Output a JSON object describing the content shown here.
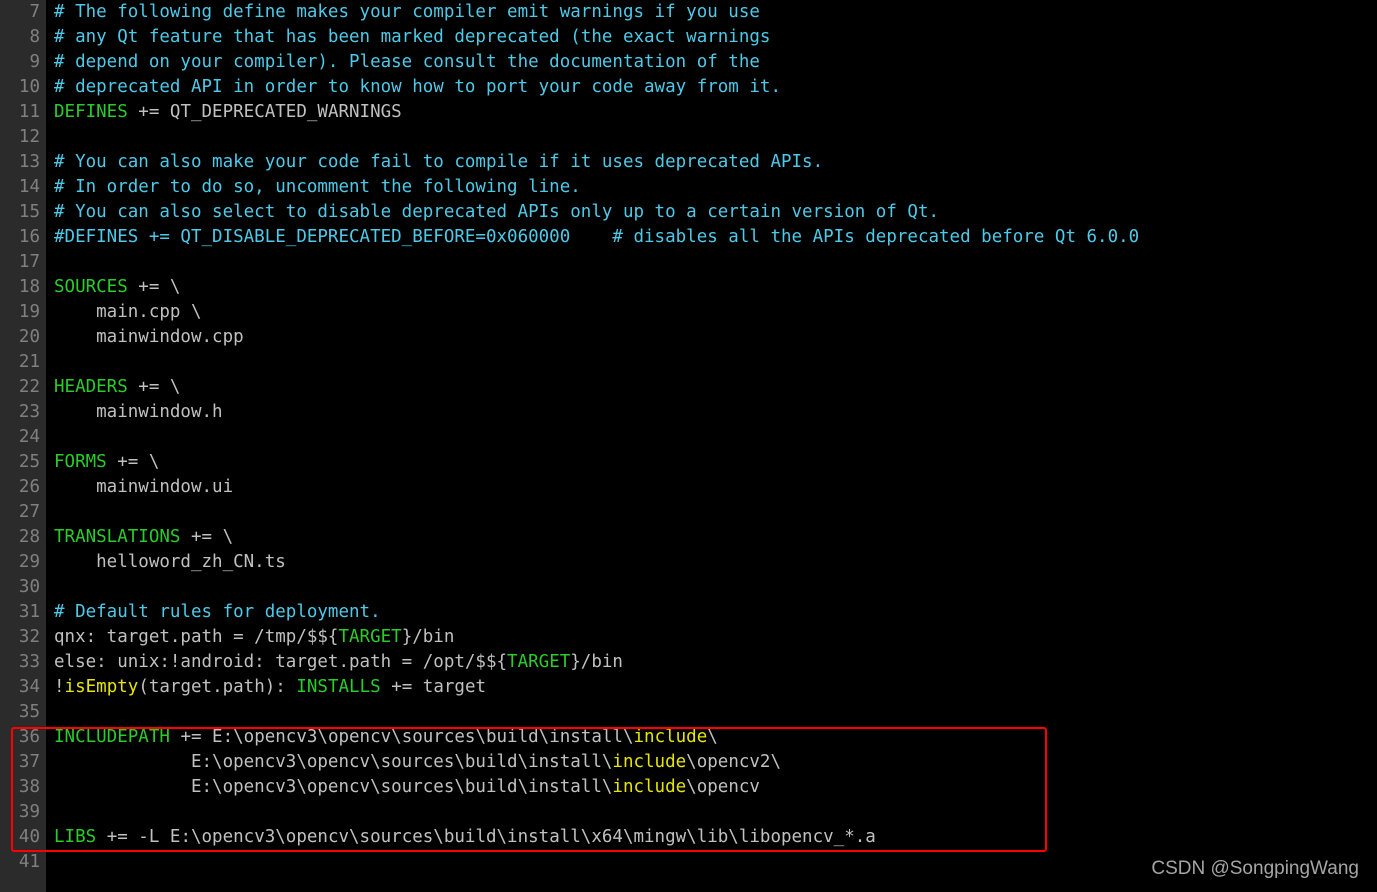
{
  "editor": {
    "filetype": "qmake-project",
    "first_line_number": 7,
    "last_line_number": 41,
    "colors": {
      "background": "#000000",
      "gutter_background": "#2b2b2b",
      "line_number": "#808080",
      "comment": "#4ec9e8",
      "keyword": "#29cc29",
      "plain_text": "#c0c0c0",
      "function": "#e6e600",
      "annotation_box": "#ff0000"
    },
    "lines": [
      {
        "n": 7,
        "tokens": [
          {
            "t": "# The following define makes your compiler emit warnings if you use",
            "c": "comment"
          }
        ]
      },
      {
        "n": 8,
        "tokens": [
          {
            "t": "# any Qt feature that has been marked deprecated (the exact warnings",
            "c": "comment"
          }
        ]
      },
      {
        "n": 9,
        "tokens": [
          {
            "t": "# depend on your compiler). Please consult the documentation of the",
            "c": "comment"
          }
        ]
      },
      {
        "n": 10,
        "tokens": [
          {
            "t": "# deprecated API in order to know how to port your code away from it.",
            "c": "comment"
          }
        ]
      },
      {
        "n": 11,
        "tokens": [
          {
            "t": "DEFINES",
            "c": "keyword"
          },
          {
            "t": " += QT_DEPRECATED_WARNINGS",
            "c": "plain"
          }
        ]
      },
      {
        "n": 12,
        "tokens": [
          {
            "t": "",
            "c": "plain"
          }
        ]
      },
      {
        "n": 13,
        "tokens": [
          {
            "t": "# You can also make your code fail to compile if it uses deprecated APIs.",
            "c": "comment"
          }
        ]
      },
      {
        "n": 14,
        "tokens": [
          {
            "t": "# In order to do so, uncomment the following line.",
            "c": "comment"
          }
        ]
      },
      {
        "n": 15,
        "tokens": [
          {
            "t": "# You can also select to disable deprecated APIs only up to a certain version of Qt.",
            "c": "comment"
          }
        ]
      },
      {
        "n": 16,
        "tokens": [
          {
            "t": "#DEFINES += QT_DISABLE_DEPRECATED_BEFORE=0x060000    # disables all the APIs deprecated before Qt 6.0.0",
            "c": "comment"
          }
        ]
      },
      {
        "n": 17,
        "tokens": [
          {
            "t": "",
            "c": "plain"
          }
        ]
      },
      {
        "n": 18,
        "tokens": [
          {
            "t": "SOURCES",
            "c": "keyword"
          },
          {
            "t": " += \\",
            "c": "plain"
          }
        ]
      },
      {
        "n": 19,
        "tokens": [
          {
            "t": "    main.cpp \\",
            "c": "plain"
          }
        ]
      },
      {
        "n": 20,
        "tokens": [
          {
            "t": "    mainwindow.cpp",
            "c": "plain"
          }
        ]
      },
      {
        "n": 21,
        "tokens": [
          {
            "t": "",
            "c": "plain"
          }
        ]
      },
      {
        "n": 22,
        "tokens": [
          {
            "t": "HEADERS",
            "c": "keyword"
          },
          {
            "t": " += \\",
            "c": "plain"
          }
        ]
      },
      {
        "n": 23,
        "tokens": [
          {
            "t": "    mainwindow.h",
            "c": "plain"
          }
        ]
      },
      {
        "n": 24,
        "tokens": [
          {
            "t": "",
            "c": "plain"
          }
        ]
      },
      {
        "n": 25,
        "tokens": [
          {
            "t": "FORMS",
            "c": "keyword"
          },
          {
            "t": " += \\",
            "c": "plain"
          }
        ]
      },
      {
        "n": 26,
        "tokens": [
          {
            "t": "    mainwindow.ui",
            "c": "plain"
          }
        ]
      },
      {
        "n": 27,
        "tokens": [
          {
            "t": "",
            "c": "plain"
          }
        ]
      },
      {
        "n": 28,
        "tokens": [
          {
            "t": "TRANSLATIONS",
            "c": "keyword"
          },
          {
            "t": " += \\",
            "c": "plain"
          }
        ]
      },
      {
        "n": 29,
        "tokens": [
          {
            "t": "    helloword_zh_CN.ts",
            "c": "plain"
          }
        ]
      },
      {
        "n": 30,
        "tokens": [
          {
            "t": "",
            "c": "plain"
          }
        ]
      },
      {
        "n": 31,
        "tokens": [
          {
            "t": "# Default rules for deployment.",
            "c": "comment"
          }
        ]
      },
      {
        "n": 32,
        "tokens": [
          {
            "t": "qnx: target.path = /tmp/$${",
            "c": "plain"
          },
          {
            "t": "TARGET",
            "c": "var"
          },
          {
            "t": "}/bin",
            "c": "plain"
          }
        ]
      },
      {
        "n": 33,
        "tokens": [
          {
            "t": "else: unix:!android: target.path = /opt/$${",
            "c": "plain"
          },
          {
            "t": "TARGET",
            "c": "var"
          },
          {
            "t": "}/bin",
            "c": "plain"
          }
        ]
      },
      {
        "n": 34,
        "tokens": [
          {
            "t": "!",
            "c": "plain"
          },
          {
            "t": "isEmpty",
            "c": "func"
          },
          {
            "t": "(target.path): ",
            "c": "plain"
          },
          {
            "t": "INSTALLS",
            "c": "keyword"
          },
          {
            "t": " += target",
            "c": "plain"
          }
        ]
      },
      {
        "n": 35,
        "tokens": [
          {
            "t": "",
            "c": "plain"
          }
        ]
      },
      {
        "n": 36,
        "tokens": [
          {
            "t": "INCLUDEPATH",
            "c": "keyword"
          },
          {
            "t": " += E:\\opencv3\\opencv\\sources\\build\\install\\",
            "c": "plain"
          },
          {
            "t": "include",
            "c": "func"
          },
          {
            "t": "\\",
            "c": "plain"
          }
        ]
      },
      {
        "n": 37,
        "tokens": [
          {
            "t": "             E:\\opencv3\\opencv\\sources\\build\\install\\",
            "c": "plain"
          },
          {
            "t": "include",
            "c": "func"
          },
          {
            "t": "\\opencv2\\",
            "c": "plain"
          }
        ]
      },
      {
        "n": 38,
        "tokens": [
          {
            "t": "             E:\\opencv3\\opencv\\sources\\build\\install\\",
            "c": "plain"
          },
          {
            "t": "include",
            "c": "func"
          },
          {
            "t": "\\opencv",
            "c": "plain"
          }
        ]
      },
      {
        "n": 39,
        "tokens": [
          {
            "t": "",
            "c": "plain"
          }
        ]
      },
      {
        "n": 40,
        "tokens": [
          {
            "t": "LIBS",
            "c": "keyword"
          },
          {
            "t": " += -L E:\\opencv3\\opencv\\sources\\build\\install\\x64\\mingw\\lib\\libopencv_*.a",
            "c": "plain"
          }
        ]
      },
      {
        "n": 41,
        "tokens": [
          {
            "t": "",
            "c": "plain"
          }
        ]
      }
    ]
  },
  "annotation": {
    "box_label": "highlight-rectangle",
    "covers_lines": "36-40"
  },
  "watermark": {
    "text": "CSDN @SongpingWang"
  }
}
